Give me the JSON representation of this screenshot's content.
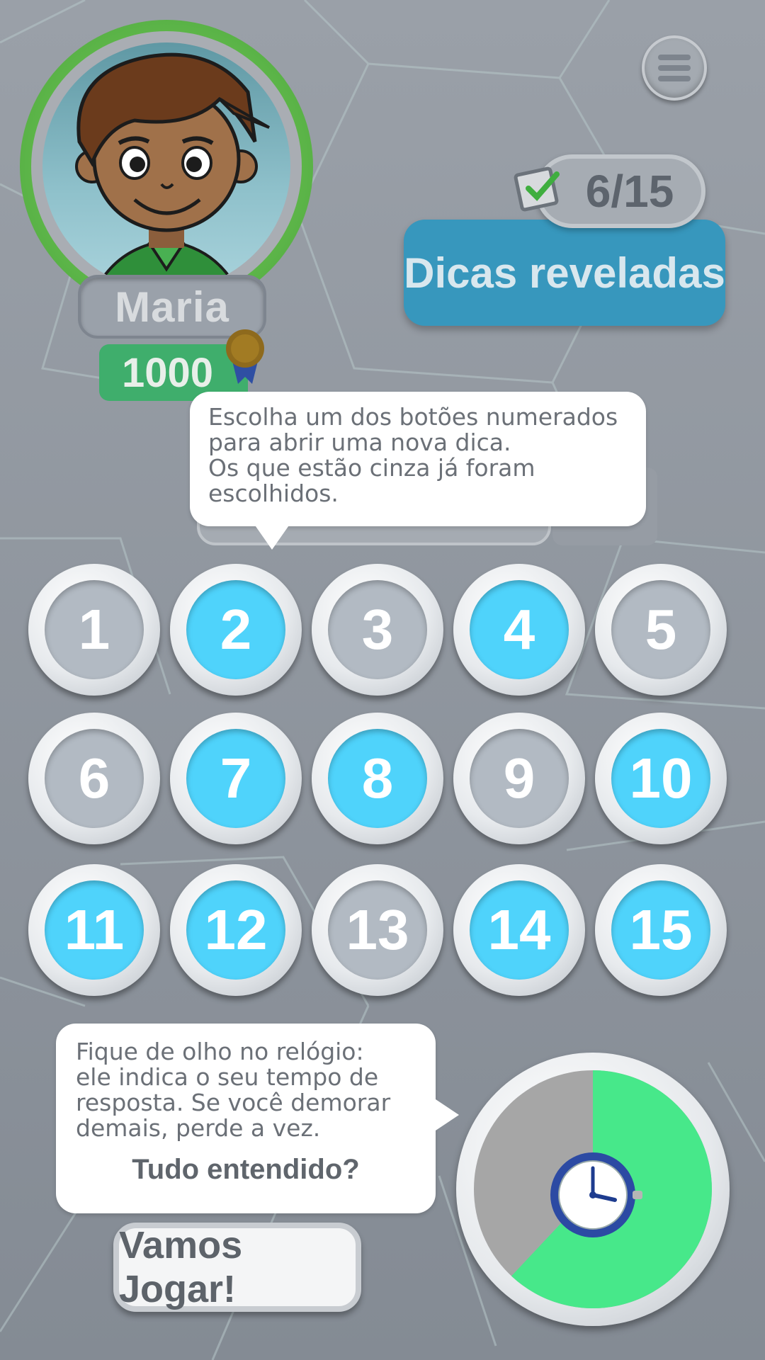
{
  "player": {
    "name": "Maria",
    "score": "1000"
  },
  "counter": {
    "value": "6/15"
  },
  "dicas_button": {
    "label": "Dicas reveladas"
  },
  "bubble_top": {
    "lines": [
      "Escolha um dos botões numerados",
      "para abrir uma nova dica.",
      "Os que estão cinza já foram",
      "escolhidos."
    ]
  },
  "buttons": [
    {
      "label": "1",
      "state": "used"
    },
    {
      "label": "2",
      "state": "active"
    },
    {
      "label": "3",
      "state": "used"
    },
    {
      "label": "4",
      "state": "active"
    },
    {
      "label": "5",
      "state": "used"
    },
    {
      "label": "6",
      "state": "used"
    },
    {
      "label": "7",
      "state": "active"
    },
    {
      "label": "8",
      "state": "active"
    },
    {
      "label": "9",
      "state": "used"
    },
    {
      "label": "10",
      "state": "active"
    },
    {
      "label": "11",
      "state": "active"
    },
    {
      "label": "12",
      "state": "active"
    },
    {
      "label": "13",
      "state": "used"
    },
    {
      "label": "14",
      "state": "active"
    },
    {
      "label": "15",
      "state": "active"
    }
  ],
  "bubble_bottom": {
    "lines": [
      "Fique de olho no relógio:",
      "ele indica o seu tempo de",
      "resposta. Se você demorar",
      "demais, perde a vez."
    ],
    "question": "Tudo entendido?"
  },
  "timer": {
    "remaining_fraction": 0.62
  },
  "play_button": {
    "label": "Vamos Jogar!"
  },
  "colors": {
    "active_button": "#4fd3fb",
    "used_button": "#b2bac3",
    "timer_remaining": "#47e88a",
    "timer_elapsed": "#a6a6a6",
    "dicas_button": "#3797bd",
    "score": "#3fae6c"
  },
  "icons": [
    "menu-icon",
    "check-icon",
    "medal-icon",
    "clock-icon"
  ]
}
